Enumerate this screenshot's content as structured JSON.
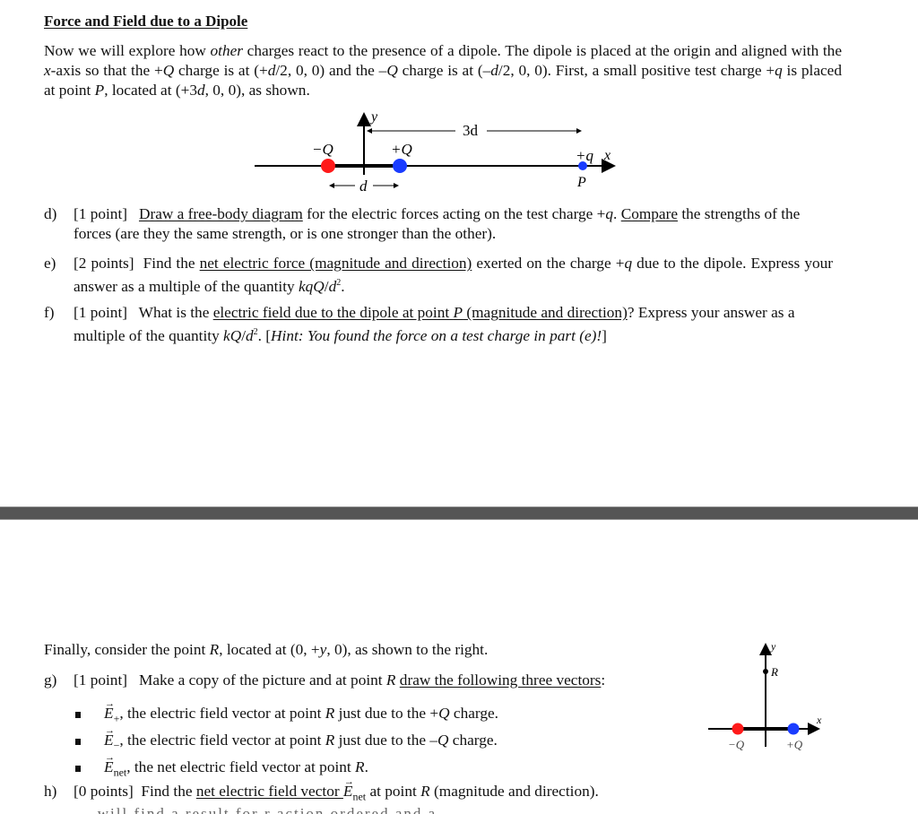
{
  "title": "Force and Field due to a Dipole",
  "intro": {
    "s1": "Now we will explore how ",
    "s1_em": "other",
    "s2": " charges react to the presence of a dipole.  The dipole is placed at the origin and aligned with the ",
    "s2_em": "x",
    "s3": "-axis so that the +",
    "s3_em": "Q",
    "s4": " charge is at (+",
    "s4_em": "d",
    "s5": "/2, 0, 0) and the –",
    "s5_em": "Q",
    "s6": " charge is at (–",
    "s6_em": "d",
    "s7": "/2, 0, 0).  First, a small positive test charge +",
    "s7_em": "q",
    "s8": " is placed at point ",
    "s8_em": "P",
    "s9": ", located at (+3",
    "s9_em": "d",
    "s10": ", 0, 0), as shown."
  },
  "diagram1": {
    "neg_label": "−Q",
    "pos_label": "+Q",
    "test_label": "+q",
    "x_label": "x",
    "y_label": "y",
    "p_label": "P",
    "d_label": "d",
    "three_d_label": "3d",
    "neg_color": "#ff1a1a",
    "pos_color": "#1a3cff"
  },
  "questions": {
    "d": {
      "label": "d)",
      "points": "[1 point]",
      "u1": "Draw a free-body diagram",
      "t1": " for the electric forces acting on the test charge +",
      "em1": "q",
      "t2": ".  ",
      "u2": "Compare",
      "t3": " the strengths of the forces (are they the same strength, or is one stronger than the other)."
    },
    "e": {
      "label": "e)",
      "points": "[2 points]",
      "t1": "Find the ",
      "u1": "net electric force (magnitude and direction)",
      "t2": " exerted on the charge +",
      "em1": "q",
      "t3": " due to the dipole. Express your answer as a multiple of the quantity ",
      "em2": "kqQ",
      "t4": "/",
      "em3": "d",
      "sup": "2",
      "t5": "."
    },
    "f": {
      "label": "f)",
      "points": "[1 point]",
      "t1": "What is the ",
      "u1": "electric field due to the dipole at point ",
      "u1_em": "P",
      "u2": " (magnitude and direction)",
      "t2": "?  Express your answer as a multiple of the quantity ",
      "em1": "kQ",
      "t3": "/",
      "em2": "d",
      "sup": "2",
      "t4": ".  [",
      "hint": "Hint: You found the force on a test charge in part (e)!",
      "t5": "]"
    },
    "finally": {
      "t1": "Finally, consider the point ",
      "em1": "R",
      "t2": ", located at (0, +",
      "em2": "y",
      "t3": ", 0), as shown to the right."
    },
    "g": {
      "label": "g)",
      "points": "[1 point]",
      "t1": "Make a copy of the picture and at point ",
      "em1": "R",
      "t2": " ",
      "u1": "draw the following three vectors",
      "t3": ":"
    },
    "bullets": [
      {
        "sym": "E",
        "sub": "+",
        "t1": ", the electric field vector at point ",
        "em": "R",
        "t2": " just due to the +",
        "em2": "Q",
        "t3": " charge."
      },
      {
        "sym": "E",
        "sub": "−",
        "t1": ", the electric field vector at point ",
        "em": "R",
        "t2": " just due to the –",
        "em2": "Q",
        "t3": " charge."
      },
      {
        "sym": "E",
        "sub": "net",
        "t1": ", the net electric field vector at point ",
        "em": "R",
        "t2": ".",
        "em2": "",
        "t3": ""
      }
    ],
    "h": {
      "label": "h)",
      "points": "[0 points]",
      "t1": "Find the ",
      "u1": "net electric field vector ",
      "sym": "E",
      "sub": "net",
      "t2": " at point ",
      "em1": "R",
      "t3": " (magnitude and direction)."
    }
  },
  "diagram2": {
    "neg_label": "−Q",
    "pos_label": "+Q",
    "x_label": "x",
    "y_label": "y",
    "r_label": "R"
  },
  "cutoff_text": "...will find a result for r action ordered and a..."
}
